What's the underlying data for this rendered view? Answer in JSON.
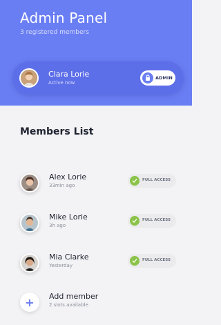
{
  "header": {
    "title": "Admin Panel",
    "subtitle": "3 registered members",
    "background": "#6a7ef3"
  },
  "current_user": {
    "name": "Clara Lorie",
    "status": "Active now",
    "role_badge": "ADMIN",
    "badge_icon": "lock-icon"
  },
  "members_list": {
    "title": "Members List",
    "members": [
      {
        "name": "Alex Lorie",
        "last_active": "33min ago",
        "access": "FULL ACCESS"
      },
      {
        "name": "Mike Lorie",
        "last_active": "3h ago",
        "access": "FULL ACCESS"
      },
      {
        "name": "Mia Clarke",
        "last_active": "Yesterday",
        "access": "FULL ACCESS"
      }
    ]
  },
  "add_member": {
    "label": "Add member",
    "slots": "2 slots available",
    "icon": "plus-icon"
  },
  "colors": {
    "accent": "#6a7ef3",
    "check_green": "#8bc34a",
    "background": "#f3f3f5"
  }
}
